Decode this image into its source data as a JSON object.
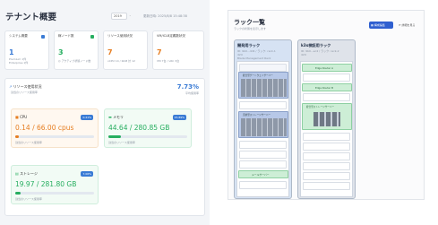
{
  "left": {
    "title": "テナント概要",
    "year_select": "2019",
    "month_select": "",
    "updated": "更新日時: 2025/8/8 15:48:38",
    "cards": [
      {
        "label": "システム概要",
        "value": "1",
        "sub": "Premium 1件\nEnterprise 1件",
        "color": "#3a7bd5",
        "dot": "#3a7bd5"
      },
      {
        "label": "稼ノード数",
        "value": "3",
        "sub": "◎ アクティブ状態ノード数",
        "color": "#27ae60",
        "dot": "#27ae60"
      },
      {
        "label": "リソース使用状況",
        "value": "7",
        "sub": "vCPU 14 / RAM 計 12",
        "color": "#e67e22",
        "dot": ""
      },
      {
        "label": "VM/ICLB定義数状況",
        "value": "7",
        "sub": "VM 7台 / vRC 3台",
        "color": "#e67e22",
        "dot": ""
      }
    ],
    "usage": {
      "title": "リソース使用状況",
      "subtitle": "割当のリソース使用率",
      "percent": "7.73%",
      "percent_sub": "平均使用率",
      "cpu": {
        "label": "CPU",
        "badge": "0.21%",
        "value": "0.14 / 66.00 cpus",
        "note": "割当のリソース使用率",
        "fill": 0.0021
      },
      "mem": {
        "label": "メモリ",
        "badge": "15.89%",
        "value": "44.64 / 280.85 GB",
        "note": "割当のリソース使用率",
        "fill": 0.1589
      },
      "storage": {
        "label": "ストレージ",
        "badge": "7.06%",
        "value": "19.97 / 281.80 GB",
        "note": "割当のリソース使用率",
        "fill": 0.0706
      }
    }
  },
  "right": {
    "title": "ラック一覧",
    "subtitle": "ラックの状態を表示します",
    "btn_primary": "構成編集",
    "btn_secondary": "詳細を見る",
    "rack1": {
      "title": "開発用ラック",
      "line1": "ID: 9b0...dd4 / ラック: rack-1",
      "line2": "42U",
      "line3": "Blade Management Rack",
      "dev1": "統合型ゲートウェイサーバー",
      "dev2": "汎用型ストレージサーバー",
      "dev3": "メールサーバー"
    },
    "rack2": {
      "title": "k3s検証用ラック",
      "line1": "ID: 9b0...ec4 / ラック: rack-2",
      "line2": "42U",
      "dev1": "Edge Router A",
      "dev2": "Edge Router B",
      "dev3": "統合型ストレージサーバー"
    }
  }
}
